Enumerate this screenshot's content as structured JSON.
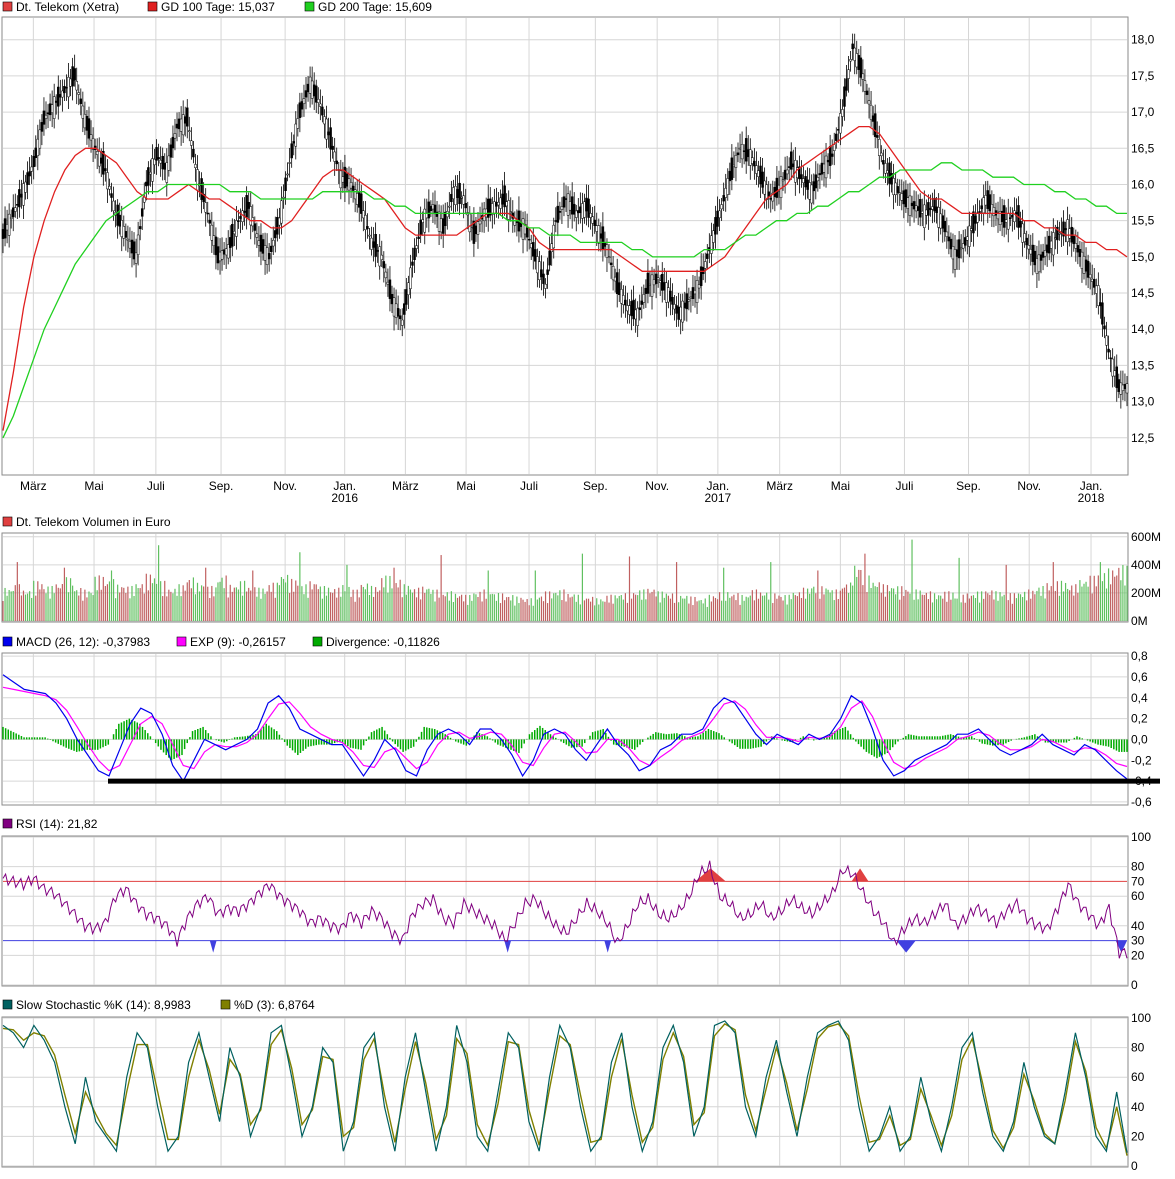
{
  "colors": {
    "grid": "#d6d6d6",
    "frame": "#8a8a8a",
    "gd100": "#e02020",
    "gd200": "#20d020",
    "candle": "#000000",
    "macd": "#0000ee",
    "exp": "#ff00ff",
    "divergence": "#00aa00",
    "rsi": "#800080",
    "rsi_hi": "#e04040",
    "rsi_lo": "#4040e0",
    "stoch_k": "#006060",
    "stoch_d": "#808000",
    "vol_up": "#60c060",
    "vol_down": "#c06060"
  },
  "chart_data": [
    {
      "type": "line",
      "id": "price",
      "legend": [
        {
          "label": "Dt. Telekom (Xetra)",
          "color": "#e04040"
        },
        {
          "label": "GD 100 Tage: 15,037",
          "color": "#e02020"
        },
        {
          "label": "GD 200 Tage: 15,609",
          "color": "#20d020"
        }
      ],
      "ylim": [
        12.0,
        18.3
      ],
      "yticks": [
        "12,5",
        "13,0",
        "13,5",
        "14,0",
        "14,5",
        "15,0",
        "15,5",
        "16,0",
        "16,5",
        "17,0",
        "17,5",
        "18,0"
      ],
      "ytick_values": [
        12.5,
        13.0,
        13.5,
        14.0,
        14.5,
        15.0,
        15.5,
        16.0,
        16.5,
        17.0,
        17.5,
        18.0
      ],
      "xticks": [
        {
          "label": "März",
          "t": 0.027,
          "year": ""
        },
        {
          "label": "Mai",
          "t": 0.081,
          "year": ""
        },
        {
          "label": "Juli",
          "t": 0.136,
          "year": ""
        },
        {
          "label": "Sep.",
          "t": 0.194,
          "year": ""
        },
        {
          "label": "Nov.",
          "t": 0.251,
          "year": ""
        },
        {
          "label": "Jan.",
          "t": 0.304,
          "year": "2016"
        },
        {
          "label": "März",
          "t": 0.358,
          "year": ""
        },
        {
          "label": "Mai",
          "t": 0.412,
          "year": ""
        },
        {
          "label": "Juli",
          "t": 0.468,
          "year": ""
        },
        {
          "label": "Sep.",
          "t": 0.527,
          "year": ""
        },
        {
          "label": "Nov.",
          "t": 0.582,
          "year": ""
        },
        {
          "label": "Jan.",
          "t": 0.636,
          "year": "2017"
        },
        {
          "label": "März",
          "t": 0.691,
          "year": ""
        },
        {
          "label": "Mai",
          "t": 0.745,
          "year": ""
        },
        {
          "label": "Juli",
          "t": 0.802,
          "year": ""
        },
        {
          "label": "Sep.",
          "t": 0.859,
          "year": ""
        },
        {
          "label": "Nov.",
          "t": 0.913,
          "year": ""
        },
        {
          "label": "Jan.",
          "t": 0.968,
          "year": "2018"
        }
      ],
      "close": [
        15.3,
        15.6,
        15.9,
        16.3,
        16.9,
        17.1,
        17.3,
        17.5,
        16.9,
        16.5,
        16.2,
        15.6,
        15.3,
        15.0,
        16.0,
        16.4,
        16.2,
        16.8,
        16.9,
        16.1,
        15.6,
        15.0,
        15.1,
        15.5,
        15.7,
        15.2,
        15.0,
        15.5,
        16.3,
        17.0,
        17.4,
        17.1,
        16.6,
        16.1,
        16.0,
        15.7,
        15.2,
        15.0,
        14.4,
        14.1,
        14.9,
        15.5,
        15.7,
        15.4,
        15.9,
        15.8,
        15.3,
        15.6,
        15.7,
        15.8,
        15.5,
        15.4,
        15.0,
        14.6,
        15.5,
        15.8,
        15.6,
        15.7,
        15.4,
        15.1,
        14.6,
        14.3,
        14.2,
        14.6,
        14.7,
        14.5,
        14.2,
        14.4,
        14.6,
        15.1,
        15.6,
        16.1,
        16.5,
        16.4,
        16.1,
        15.8,
        16.0,
        16.3,
        16.1,
        15.9,
        16.2,
        16.4,
        17.0,
        17.9,
        17.5,
        16.9,
        16.3,
        16.0,
        15.8,
        15.7,
        15.6,
        15.7,
        15.4,
        15.0,
        15.2,
        15.5,
        15.8,
        15.6,
        15.5,
        15.6,
        15.2,
        14.9,
        15.1,
        15.3,
        15.4,
        15.1,
        14.8,
        14.5,
        13.7,
        13.2
      ],
      "gd100": [
        12.6,
        13.4,
        14.3,
        15.0,
        15.5,
        15.9,
        16.2,
        16.4,
        16.5,
        16.5,
        16.4,
        16.3,
        16.1,
        15.9,
        15.8,
        15.8,
        15.8,
        15.9,
        16.0,
        15.9,
        15.8,
        15.8,
        15.7,
        15.6,
        15.5,
        15.5,
        15.4,
        15.4,
        15.5,
        15.7,
        15.9,
        16.1,
        16.2,
        16.2,
        16.1,
        16.0,
        15.9,
        15.8,
        15.6,
        15.4,
        15.3,
        15.3,
        15.3,
        15.3,
        15.3,
        15.4,
        15.5,
        15.6,
        15.6,
        15.6,
        15.5,
        15.4,
        15.2,
        15.1,
        15.1,
        15.1,
        15.1,
        15.1,
        15.1,
        15.1,
        15.0,
        14.9,
        14.8,
        14.8,
        14.8,
        14.8,
        14.8,
        14.8,
        14.8,
        14.9,
        15.0,
        15.2,
        15.4,
        15.6,
        15.8,
        15.9,
        16.0,
        16.2,
        16.3,
        16.4,
        16.5,
        16.6,
        16.7,
        16.8,
        16.8,
        16.7,
        16.5,
        16.3,
        16.1,
        15.9,
        15.8,
        15.8,
        15.7,
        15.6,
        15.6,
        15.6,
        15.6,
        15.6,
        15.6,
        15.5,
        15.5,
        15.4,
        15.4,
        15.3,
        15.3,
        15.2,
        15.2,
        15.1,
        15.1,
        15.0
      ],
      "gd200": [
        12.5,
        12.8,
        13.2,
        13.6,
        14.0,
        14.3,
        14.6,
        14.9,
        15.1,
        15.3,
        15.5,
        15.6,
        15.7,
        15.8,
        15.9,
        15.9,
        16.0,
        16.0,
        16.0,
        16.0,
        16.0,
        16.0,
        15.9,
        15.9,
        15.9,
        15.8,
        15.8,
        15.8,
        15.8,
        15.8,
        15.8,
        15.9,
        15.9,
        15.9,
        15.9,
        15.9,
        15.8,
        15.8,
        15.7,
        15.7,
        15.6,
        15.6,
        15.6,
        15.6,
        15.6,
        15.6,
        15.6,
        15.6,
        15.6,
        15.5,
        15.5,
        15.4,
        15.4,
        15.3,
        15.3,
        15.3,
        15.2,
        15.2,
        15.2,
        15.2,
        15.2,
        15.1,
        15.1,
        15.0,
        15.0,
        15.0,
        15.0,
        15.0,
        15.1,
        15.1,
        15.1,
        15.2,
        15.3,
        15.3,
        15.4,
        15.5,
        15.5,
        15.6,
        15.6,
        15.7,
        15.7,
        15.8,
        15.9,
        15.9,
        16.0,
        16.1,
        16.1,
        16.2,
        16.2,
        16.2,
        16.2,
        16.3,
        16.3,
        16.2,
        16.2,
        16.2,
        16.1,
        16.1,
        16.1,
        16.0,
        16.0,
        16.0,
        15.9,
        15.9,
        15.8,
        15.8,
        15.7,
        15.7,
        15.6,
        15.6
      ]
    },
    {
      "type": "bar",
      "id": "volume",
      "legend": [
        {
          "label": "Dt. Telekom Volumen in Euro",
          "color": "#e04040"
        }
      ],
      "yticks": [
        "600M",
        "400M",
        "200M",
        "0M"
      ],
      "ytick_values": [
        600,
        400,
        200,
        0
      ],
      "ylim": [
        0,
        620
      ],
      "values": [
        190,
        210,
        180,
        230,
        200,
        220,
        250,
        190,
        180,
        260,
        240,
        210,
        200,
        220,
        270,
        230,
        190,
        210,
        250,
        220,
        200,
        260,
        210,
        230,
        200,
        190,
        220,
        270,
        240,
        210,
        230,
        200,
        190,
        210,
        180,
        220,
        200,
        260,
        240,
        210,
        190,
        200,
        180,
        170,
        160,
        150,
        170,
        180,
        160,
        150,
        140,
        130,
        150,
        170,
        180,
        160,
        150,
        140,
        130,
        150,
        160,
        170,
        180,
        190,
        170,
        160,
        150,
        140,
        130,
        150,
        170,
        160,
        150,
        180,
        170,
        160,
        150,
        170,
        190,
        210,
        200,
        180,
        220,
        320,
        260,
        230,
        210,
        200,
        190,
        180,
        170,
        160,
        170,
        150,
        160,
        170,
        180,
        170,
        160,
        170,
        180,
        200,
        220,
        230,
        210,
        240,
        260,
        280,
        300,
        320
      ],
      "spikes": [
        420,
        380,
        360,
        540,
        380,
        360,
        490,
        400,
        380,
        470,
        360,
        360,
        480,
        460,
        420,
        380,
        420,
        360,
        480,
        580,
        450,
        400,
        420,
        420
      ]
    },
    {
      "type": "line",
      "id": "macd",
      "legend": [
        {
          "label": "MACD (26, 12): -0,37983",
          "color": "#0000ee"
        },
        {
          "label": "EXP (9): -0,26157",
          "color": "#ff00ff"
        },
        {
          "label": "Divergence: -0,11826",
          "color": "#00aa00"
        }
      ],
      "ylim": [
        -0.62,
        0.82
      ],
      "yticks": [
        "0,8",
        "0,6",
        "0,4",
        "0,2",
        "0,0",
        "-0,2",
        "-0,4",
        "-0,6"
      ],
      "ytick_values": [
        0.8,
        0.6,
        0.4,
        0.2,
        0.0,
        -0.2,
        -0.4,
        -0.6
      ],
      "annotation_line_y": -0.4,
      "macd": [
        0.62,
        0.55,
        0.48,
        0.46,
        0.44,
        0.35,
        0.2,
        0.0,
        -0.15,
        -0.3,
        -0.35,
        -0.1,
        0.15,
        0.3,
        0.25,
        0.05,
        -0.25,
        -0.4,
        -0.2,
        0.0,
        -0.05,
        -0.1,
        -0.05,
        0.0,
        0.1,
        0.35,
        0.42,
        0.3,
        0.1,
        0.05,
        0.0,
        -0.05,
        -0.05,
        -0.2,
        -0.35,
        -0.2,
        0.0,
        -0.1,
        -0.3,
        -0.35,
        -0.1,
        0.05,
        0.1,
        0.05,
        -0.05,
        0.1,
        0.1,
        0.0,
        -0.15,
        -0.35,
        -0.2,
        0.05,
        0.1,
        0.05,
        -0.1,
        -0.2,
        -0.05,
        0.1,
        -0.05,
        -0.15,
        -0.3,
        -0.25,
        -0.1,
        -0.05,
        0.05,
        0.05,
        0.1,
        0.3,
        0.4,
        0.35,
        0.2,
        0.05,
        -0.05,
        0.05,
        0.0,
        -0.05,
        0.05,
        0.0,
        0.05,
        0.2,
        0.42,
        0.35,
        0.1,
        -0.2,
        -0.35,
        -0.3,
        -0.2,
        -0.15,
        -0.1,
        -0.05,
        0.05,
        0.05,
        0.1,
        0.0,
        -0.1,
        -0.15,
        -0.1,
        -0.05,
        0.05,
        -0.05,
        -0.1,
        -0.15,
        -0.05,
        -0.1,
        -0.2,
        -0.3,
        -0.38
      ],
      "exp": [
        0.5,
        0.48,
        0.46,
        0.44,
        0.42,
        0.38,
        0.28,
        0.12,
        -0.05,
        -0.2,
        -0.3,
        -0.25,
        -0.05,
        0.15,
        0.22,
        0.15,
        -0.05,
        -0.25,
        -0.28,
        -0.12,
        -0.05,
        -0.07,
        -0.07,
        -0.03,
        0.05,
        0.2,
        0.34,
        0.36,
        0.25,
        0.12,
        0.05,
        0.0,
        -0.03,
        -0.12,
        -0.25,
        -0.27,
        -0.12,
        -0.08,
        -0.18,
        -0.28,
        -0.22,
        -0.05,
        0.05,
        0.07,
        0.01,
        0.03,
        0.07,
        0.05,
        -0.06,
        -0.22,
        -0.25,
        -0.08,
        0.05,
        0.07,
        -0.02,
        -0.13,
        -0.12,
        0.0,
        0.0,
        -0.08,
        -0.2,
        -0.25,
        -0.17,
        -0.1,
        -0.01,
        0.03,
        0.07,
        0.2,
        0.34,
        0.37,
        0.29,
        0.14,
        0.02,
        0.02,
        0.01,
        -0.02,
        0.02,
        0.01,
        0.03,
        0.12,
        0.3,
        0.37,
        0.22,
        -0.02,
        -0.22,
        -0.28,
        -0.25,
        -0.18,
        -0.13,
        -0.08,
        0.0,
        0.03,
        0.07,
        0.04,
        -0.04,
        -0.1,
        -0.1,
        -0.07,
        0.0,
        -0.02,
        -0.07,
        -0.12,
        -0.08,
        -0.09,
        -0.15,
        -0.23,
        -0.26
      ]
    },
    {
      "type": "line",
      "id": "rsi",
      "legend": [
        {
          "label": "RSI (14): 21,82",
          "color": "#800080"
        }
      ],
      "ylim": [
        0,
        100
      ],
      "yticks": [
        "100",
        "80",
        "60",
        "40",
        "20",
        "0"
      ],
      "ytick_values": [
        100,
        80,
        60,
        40,
        20,
        0
      ],
      "upper": 70,
      "lower": 30,
      "upper_label": "70",
      "lower_label": "30",
      "values": [
        72,
        70,
        68,
        72,
        65,
        62,
        55,
        48,
        40,
        38,
        42,
        60,
        65,
        55,
        48,
        45,
        40,
        30,
        45,
        55,
        60,
        48,
        52,
        50,
        55,
        62,
        68,
        60,
        55,
        50,
        42,
        45,
        40,
        38,
        48,
        42,
        50,
        45,
        35,
        30,
        48,
        55,
        58,
        45,
        42,
        55,
        50,
        45,
        40,
        30,
        42,
        55,
        58,
        48,
        40,
        35,
        45,
        55,
        50,
        42,
        28,
        40,
        55,
        58,
        48,
        45,
        50,
        60,
        75,
        80,
        60,
        55,
        45,
        48,
        55,
        45,
        50,
        58,
        52,
        48,
        55,
        62,
        78,
        75,
        62,
        50,
        42,
        28,
        38,
        45,
        42,
        48,
        55,
        40,
        45,
        52,
        48,
        42,
        50,
        55,
        45,
        40,
        38,
        52,
        68,
        55,
        48,
        40,
        52,
        22
      ],
      "overbought_spans": [
        [
          0.616,
          0.643
        ],
        [
          0.755,
          0.77
        ]
      ],
      "oversold_spans": [
        [
          0.184,
          0.19
        ],
        [
          0.446,
          0.452
        ],
        [
          0.535,
          0.541
        ],
        [
          0.795,
          0.812
        ],
        [
          0.99,
          1.0
        ]
      ]
    },
    {
      "type": "line",
      "id": "stoch",
      "legend": [
        {
          "label": "Slow Stochastic %K (14): 8,9983",
          "color": "#006060"
        },
        {
          "label": "%D (3): 6,8764",
          "color": "#808000"
        }
      ],
      "ylim": [
        0,
        100
      ],
      "yticks": [
        "100",
        "80",
        "60",
        "40",
        "20",
        "0"
      ],
      "ytick_values": [
        100,
        80,
        60,
        40,
        20,
        0
      ],
      "k": [
        95,
        90,
        80,
        95,
        85,
        70,
        40,
        15,
        60,
        30,
        20,
        10,
        60,
        90,
        80,
        40,
        10,
        20,
        70,
        90,
        60,
        30,
        80,
        60,
        20,
        40,
        90,
        95,
        60,
        20,
        40,
        80,
        70,
        10,
        30,
        80,
        90,
        40,
        10,
        60,
        90,
        50,
        10,
        40,
        95,
        70,
        20,
        10,
        50,
        90,
        80,
        30,
        10,
        60,
        95,
        80,
        40,
        10,
        20,
        70,
        90,
        40,
        10,
        30,
        80,
        95,
        70,
        20,
        40,
        95,
        98,
        90,
        40,
        20,
        60,
        85,
        50,
        20,
        60,
        90,
        95,
        98,
        85,
        40,
        10,
        20,
        40,
        10,
        20,
        60,
        30,
        10,
        40,
        80,
        90,
        50,
        20,
        10,
        30,
        70,
        40,
        20,
        15,
        50,
        90,
        60,
        20,
        10,
        50,
        9
      ],
      "d": [
        93,
        92,
        85,
        90,
        88,
        75,
        48,
        22,
        50,
        35,
        22,
        14,
        50,
        82,
        82,
        50,
        18,
        18,
        60,
        85,
        65,
        35,
        72,
        62,
        28,
        38,
        82,
        92,
        66,
        28,
        38,
        74,
        72,
        20,
        26,
        72,
        86,
        48,
        16,
        52,
        84,
        56,
        18,
        34,
        86,
        76,
        28,
        14,
        42,
        84,
        82,
        38,
        14,
        52,
        88,
        82,
        48,
        16,
        18,
        60,
        86,
        48,
        16,
        26,
        72,
        90,
        74,
        28,
        36,
        88,
        96,
        92,
        48,
        24,
        52,
        80,
        56,
        24,
        52,
        86,
        94,
        96,
        88,
        48,
        16,
        18,
        34,
        14,
        18,
        52,
        34,
        14,
        34,
        72,
        86,
        56,
        24,
        12,
        26,
        62,
        44,
        22,
        15,
        44,
        84,
        64,
        26,
        12,
        40,
        7
      ]
    }
  ]
}
